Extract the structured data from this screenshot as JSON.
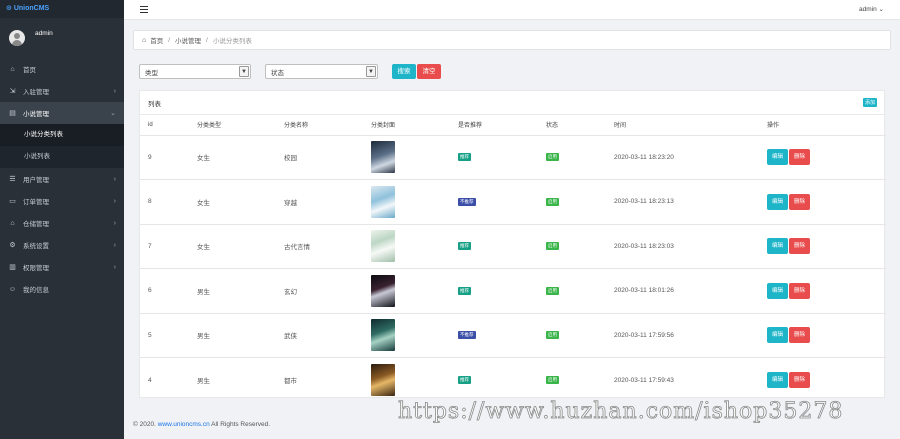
{
  "app": {
    "logo": "UnionCMS"
  },
  "user": {
    "name": "admin"
  },
  "sidebar": {
    "items": [
      {
        "label": "首页",
        "icon": "home-icon",
        "glyph": "⌂",
        "chevron": ""
      },
      {
        "label": "入驻管理",
        "icon": "entry-icon",
        "glyph": "⇲",
        "chevron": "›"
      },
      {
        "label": "小说管理",
        "icon": "book-icon",
        "glyph": "▤",
        "chevron": "⌄"
      },
      {
        "label": "用户管理",
        "icon": "users-icon",
        "glyph": "☰",
        "chevron": "›"
      },
      {
        "label": "订单管理",
        "icon": "order-icon",
        "glyph": "▭",
        "chevron": "›"
      },
      {
        "label": "仓储管理",
        "icon": "warehouse-icon",
        "glyph": "⌂",
        "chevron": "›"
      },
      {
        "label": "系统设置",
        "icon": "gear-icon",
        "glyph": "⚙",
        "chevron": "›"
      },
      {
        "label": "权限管理",
        "icon": "permission-icon",
        "glyph": "▥",
        "chevron": "›"
      },
      {
        "label": "我的信息",
        "icon": "profile-icon",
        "glyph": "☺",
        "chevron": ""
      }
    ],
    "subitems": [
      {
        "label": "小说分类列表"
      },
      {
        "label": "小说列表"
      }
    ]
  },
  "topbar": {
    "admin_label": "admin ⌄"
  },
  "breadcrumb": {
    "home": "首页",
    "section": "小说管理",
    "current": "小说分类列表",
    "sep": "/"
  },
  "filters": {
    "type_value": "类型",
    "status_value": "状态",
    "arrow": "▼",
    "search_label": "搜索",
    "clear_label": "清空"
  },
  "list": {
    "title": "列表",
    "add_label": "添加",
    "columns": [
      "id",
      "分类类型",
      "分类名称",
      "分类封面",
      "是否推荐",
      "状态",
      "时间",
      "操作"
    ],
    "rows": [
      {
        "id": "9",
        "type": "女生",
        "name": "校园",
        "recommend": "推荐",
        "status": "启用",
        "time": "2020-03-11 18:23:20",
        "edit": "编辑",
        "delete": "删除"
      },
      {
        "id": "8",
        "type": "女生",
        "name": "穿越",
        "recommend": "不推荐",
        "status": "启用",
        "time": "2020-03-11 18:23:13",
        "edit": "编辑",
        "delete": "删除"
      },
      {
        "id": "7",
        "type": "女生",
        "name": "古代言情",
        "recommend": "推荐",
        "status": "启用",
        "time": "2020-03-11 18:23:03",
        "edit": "编辑",
        "delete": "删除"
      },
      {
        "id": "6",
        "type": "男生",
        "name": "玄幻",
        "recommend": "推荐",
        "status": "启用",
        "time": "2020-03-11 18:01:26",
        "edit": "编辑",
        "delete": "删除"
      },
      {
        "id": "5",
        "type": "男生",
        "name": "武侠",
        "recommend": "不推荐",
        "status": "启用",
        "time": "2020-03-11 17:59:56",
        "edit": "编辑",
        "delete": "删除"
      },
      {
        "id": "4",
        "type": "男生",
        "name": "都市",
        "recommend": "推荐",
        "status": "启用",
        "time": "2020-03-11 17:59:43",
        "edit": "编辑",
        "delete": "删除"
      }
    ]
  },
  "footer": {
    "prefix": "© 2020.",
    "link": "www.unioncms.cn",
    "suffix": "All Rights Reserved."
  },
  "watermark": "https://www.huzhan.com/ishop35278",
  "colors": {
    "sidebar": "#2a3038",
    "primary": "#1fb5c9",
    "danger": "#e84c4c",
    "recommend": "#16a085",
    "not_recommend": "#3b4fa8",
    "enabled": "#39b54a"
  }
}
